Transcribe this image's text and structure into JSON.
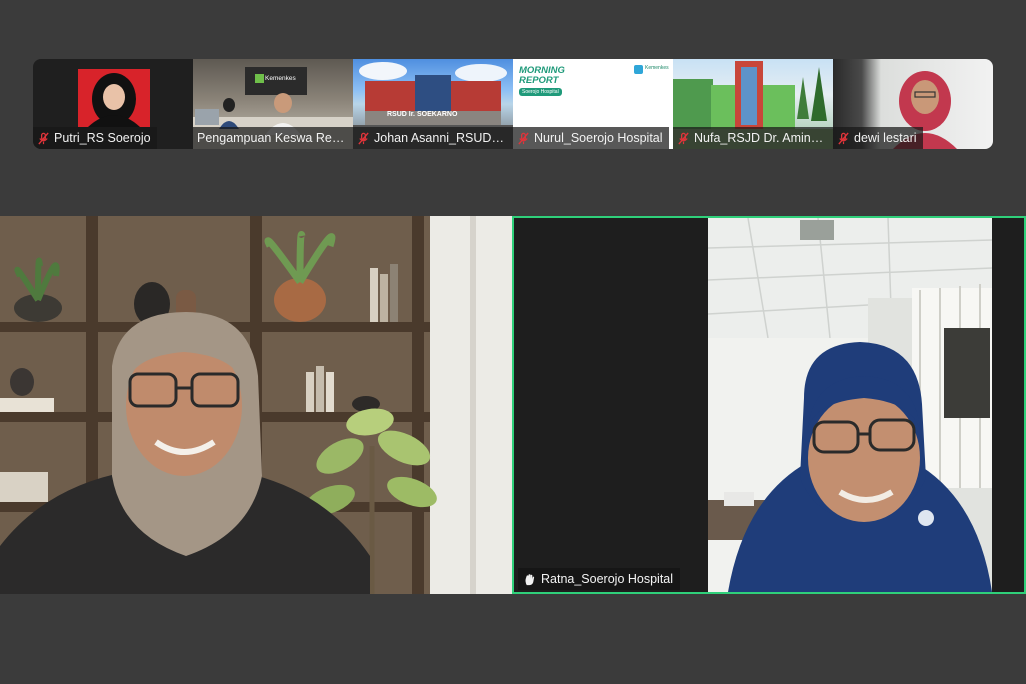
{
  "participants_strip": [
    {
      "name": "Putri_RS Soerojo",
      "muted": true
    },
    {
      "name": "Pengampuan Keswa Reg...",
      "muted": false
    },
    {
      "name": "Johan Asanni_RSUD Ir....",
      "muted": true
    },
    {
      "name": "Nurul_Soerojo Hospital",
      "muted": true
    },
    {
      "name": "Nufa_RSJD Dr. Amino...",
      "muted": true
    },
    {
      "name": "dewi lestari",
      "muted": true
    }
  ],
  "tile_content": {
    "keswa_sign": "Kemenkes",
    "johan_building_sign": "RSUD Ir. SOEKARNO",
    "nurul_slide_title": "MORNING REPORT",
    "nurul_slide_subtitle": "Soerojo Hospital",
    "nurul_logo_text": "Kemenkes"
  },
  "main_videos": [
    {
      "name": "",
      "active_speaker": false
    },
    {
      "name": "Ratna_Soerojo Hospital",
      "active_speaker": true,
      "hand_raised": true
    }
  ],
  "colors": {
    "background": "#3b3b3b",
    "active_speaker_border": "#2fd07a",
    "mute_icon": "#e0343a"
  }
}
